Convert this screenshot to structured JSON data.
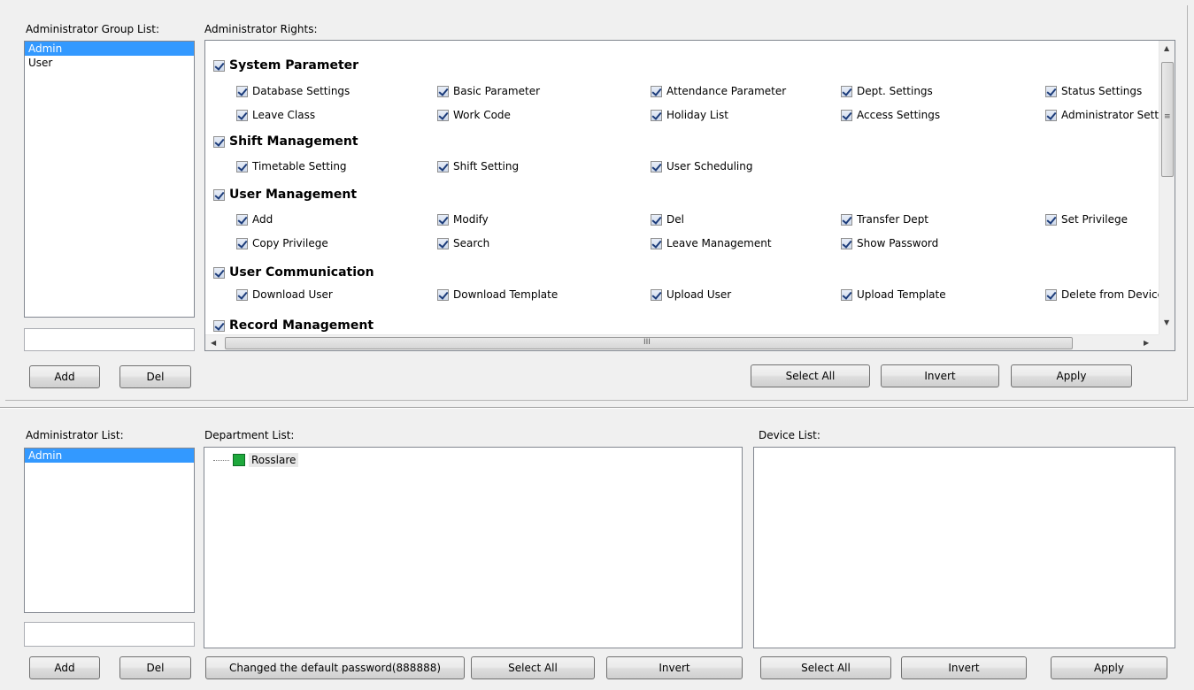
{
  "labels": {
    "admin_group_list": "Administrator Group List:",
    "admin_rights": "Administrator Rights:",
    "admin_list": "Administrator List:",
    "department_list": "Department List:",
    "device_list": "Device List:"
  },
  "group_list": {
    "items": [
      "Admin",
      "User"
    ],
    "selected": "Admin",
    "input_value": ""
  },
  "admin_list": {
    "items": [
      "Admin"
    ],
    "selected": "Admin",
    "input_value": ""
  },
  "rights": {
    "groups": [
      {
        "name": "System Parameter",
        "checked": true
      },
      {
        "name": "Shift Management",
        "checked": true
      },
      {
        "name": "User Management",
        "checked": true
      },
      {
        "name": "User Communication",
        "checked": true
      },
      {
        "name": "Record Management",
        "checked": true
      }
    ],
    "items": [
      [
        "Database Settings",
        "Basic Parameter",
        "Attendance Parameter",
        "Dept. Settings",
        "Status Settings"
      ],
      [
        "Leave Class",
        "Work Code",
        "Holiday List",
        "Access Settings",
        "Administrator Settings"
      ],
      [
        "Timetable Setting",
        "Shift Setting",
        "User Scheduling"
      ],
      [
        "Add",
        "Modify",
        "Del",
        "Transfer Dept",
        "Set Privilege"
      ],
      [
        "Copy Privilege",
        "Search",
        "Leave Management",
        "Show Password"
      ],
      [
        "Download User",
        "Download Template",
        "Upload User",
        "Upload Template",
        "Delete from Device"
      ]
    ],
    "scroll_h_grip": "III",
    "scroll_v_grip": "≡"
  },
  "department_tree": {
    "root": "Rosslare"
  },
  "buttons": {
    "group_add": "Add",
    "group_del": "Del",
    "rights_select_all": "Select All",
    "rights_invert": "Invert",
    "rights_apply": "Apply",
    "admin_add": "Add",
    "admin_del": "Del",
    "change_password": "Changed the default password(888888)",
    "dept_select_all": "Select All",
    "dept_invert": "Invert",
    "device_select_all": "Select All",
    "device_invert": "Invert",
    "device_apply": "Apply"
  },
  "colors": {
    "selection": "#3399ff",
    "tree_icon": "#1ea83c",
    "window_bg": "#f0f0f0"
  }
}
